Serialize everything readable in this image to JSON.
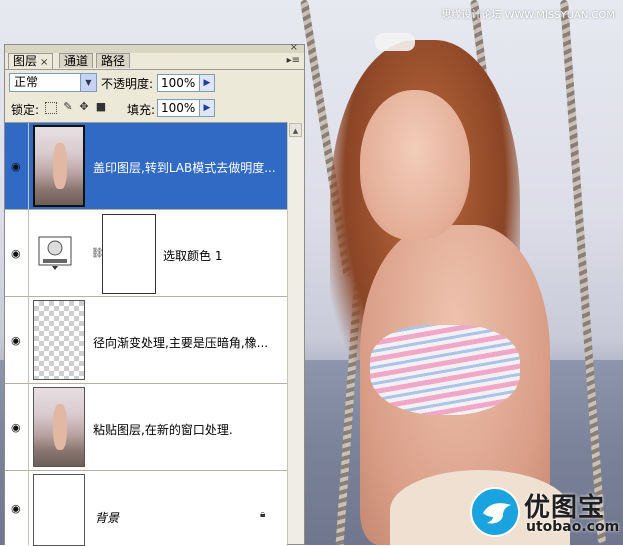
{
  "watermark": "思缘设计论坛 WWW.MISSYUAN.COM",
  "logo": {
    "name": "优图宝",
    "url": "utobao.com",
    "brand_color": "#1aa3df"
  },
  "panel": {
    "tabs": [
      {
        "label": "图层",
        "active": true,
        "close": "×"
      },
      {
        "label": "通道",
        "active": false
      },
      {
        "label": "路径",
        "active": false
      }
    ],
    "close_button": "×",
    "menu_button": "▸≡",
    "blend_mode": "正常",
    "opacity_label": "不透明度:",
    "opacity_value": "100%",
    "lock_label": "锁定:",
    "fill_label": "填充:",
    "fill_value": "100%",
    "selection_color": "#316ac5"
  },
  "layers": [
    {
      "name": "盖印图层,转到LAB模式去做明度...",
      "visible": true,
      "selected": true,
      "thumb": "photo"
    },
    {
      "name": "选取颜色 1",
      "visible": true,
      "selected": false,
      "thumb": "adjustment-with-mask"
    },
    {
      "name": "径向渐变处理,主要是压暗角,橡...",
      "visible": true,
      "selected": false,
      "thumb": "transparent"
    },
    {
      "name": "粘贴图层,在新的窗口处理.",
      "visible": true,
      "selected": false,
      "thumb": "photo"
    },
    {
      "name": "背景",
      "visible": true,
      "selected": false,
      "thumb": "white",
      "locked": true
    }
  ]
}
